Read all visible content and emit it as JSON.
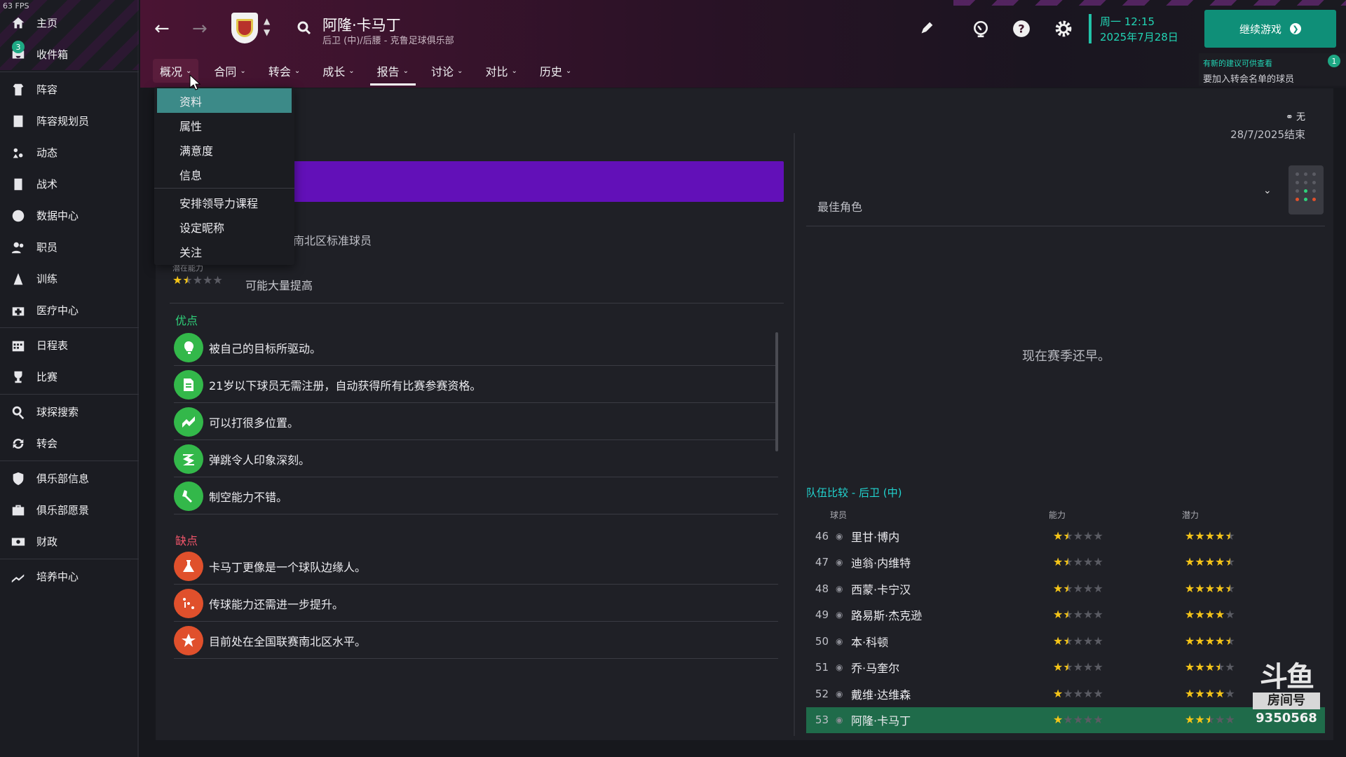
{
  "fps": "63 FPS",
  "sidebar": {
    "inbox_badge": "3",
    "items": [
      {
        "label": "主页",
        "icon": "home-icon"
      },
      {
        "label": "收件箱",
        "icon": "inbox-icon"
      },
      {
        "label": "阵容",
        "icon": "squad-icon"
      },
      {
        "label": "阵容规划员",
        "icon": "planner-icon"
      },
      {
        "label": "动态",
        "icon": "dynamics-icon"
      },
      {
        "label": "战术",
        "icon": "tactics-icon"
      },
      {
        "label": "数据中心",
        "icon": "data-hub-icon"
      },
      {
        "label": "职员",
        "icon": "staff-icon"
      },
      {
        "label": "训练",
        "icon": "training-icon"
      },
      {
        "label": "医疗中心",
        "icon": "medical-icon"
      },
      {
        "label": "日程表",
        "icon": "calendar-icon"
      },
      {
        "label": "比赛",
        "icon": "trophy-icon"
      },
      {
        "label": "球探搜索",
        "icon": "scouting-icon"
      },
      {
        "label": "转会",
        "icon": "transfer-icon"
      },
      {
        "label": "俱乐部信息",
        "icon": "shield-icon"
      },
      {
        "label": "俱乐部愿景",
        "icon": "briefcase-icon"
      },
      {
        "label": "财政",
        "icon": "money-icon"
      },
      {
        "label": "培养中心",
        "icon": "development-icon"
      }
    ]
  },
  "header": {
    "player_name": "阿隆·卡马丁",
    "player_sub": "后卫 (中)/后腰 - 克鲁足球俱乐部",
    "clock_day": "周一 12:15",
    "clock_date": "2025年7月28日",
    "continue_label": "继续游戏",
    "tabs": [
      "概况",
      "合同",
      "转会",
      "成长",
      "报告",
      "讨论",
      "对比",
      "历史"
    ],
    "notice_title": "有新的建议可供查看",
    "notice_text": "要加入转会名单的球员",
    "notice_badge": "1"
  },
  "dropdown": [
    "资料",
    "属性",
    "满意度",
    "信息",
    "安排领导力课程",
    "设定昵称",
    "关注"
  ],
  "profile": {
    "scout_status": "无",
    "end_date": "28/7/2025结束",
    "league_text": "南北区标准球员",
    "potential_label": "潜在能力",
    "potential_stars": 1.5,
    "potential_text": "可能大量提高",
    "pros_title": "优点",
    "pros": [
      {
        "text": "被自己的目标所驱动。",
        "icon": "target-head-icon"
      },
      {
        "text": "21岁以下球员无需注册，自动获得所有比赛参赛资格。",
        "icon": "document-icon"
      },
      {
        "text": "可以打很多位置。",
        "icon": "versatile-icon"
      },
      {
        "text": "弹跳令人印象深刻。",
        "icon": "jump-icon"
      },
      {
        "text": "制空能力不错。",
        "icon": "aerial-icon"
      }
    ],
    "cons_title": "缺点",
    "cons": [
      {
        "text": "卡马丁更像是一个球队边缘人。",
        "icon": "flask-icon"
      },
      {
        "text": "传球能力还需进一步提升。",
        "icon": "pass-icon"
      },
      {
        "text": "目前处在全国联赛南北区水平。",
        "icon": "star-badge-icon"
      }
    ]
  },
  "best_role": {
    "label": "最佳角色",
    "empty_text": "现在赛季还早。"
  },
  "comparison": {
    "title": "队伍比较 - 后卫 (中)",
    "col_player": "球员",
    "col_ability": "能力",
    "col_potential": "潜力",
    "rows": [
      {
        "rank": "46",
        "name": "里甘·博内",
        "ability": 1.5,
        "potential": 4.5
      },
      {
        "rank": "47",
        "name": "迪翁·内维特",
        "ability": 1.5,
        "potential": 4.5
      },
      {
        "rank": "48",
        "name": "西蒙·卡宁汉",
        "ability": 1.5,
        "potential": 4.5
      },
      {
        "rank": "49",
        "name": "路易斯·杰克逊",
        "ability": 1.5,
        "potential": 4
      },
      {
        "rank": "50",
        "name": "本·科顿",
        "ability": 1.5,
        "potential": 4.5
      },
      {
        "rank": "51",
        "name": "乔·马奎尔",
        "ability": 1.5,
        "potential": 3.5
      },
      {
        "rank": "52",
        "name": "戴维·达维森",
        "ability": 1,
        "potential": 4
      },
      {
        "rank": "53",
        "name": "阿隆·卡马丁",
        "ability": 1,
        "potential": 2.5,
        "highlight": true
      }
    ]
  },
  "watermark": {
    "logo": "斗鱼",
    "room": "房间号",
    "room_id": "9350568"
  },
  "colors": {
    "accent_teal": "#22d4b4",
    "continue_button": "#0f8f78",
    "purple_bar": "#6210b8",
    "pros_green": "#2fd17a",
    "cons_red": "#f0556a",
    "star": "#f5c518",
    "highlight_row": "#1f6b4a"
  }
}
